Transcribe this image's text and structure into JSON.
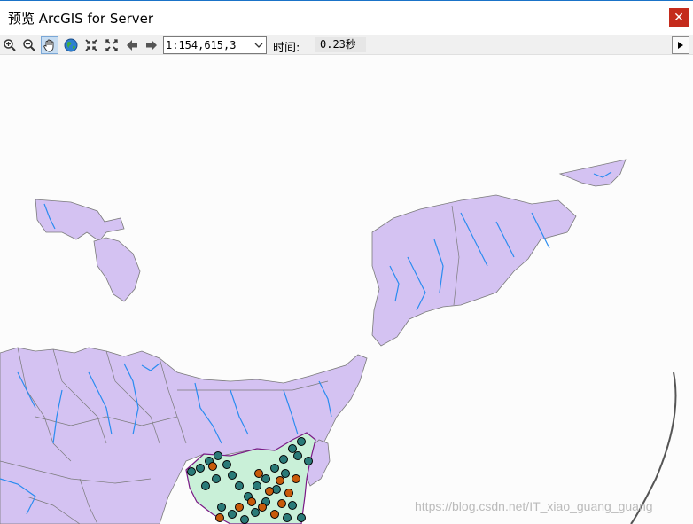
{
  "window": {
    "title": "预览 ArcGIS for Server",
    "close_glyph": "✕"
  },
  "toolbar": {
    "tools": [
      {
        "name": "zoom-in-icon"
      },
      {
        "name": "zoom-out-icon"
      },
      {
        "name": "pan-hand-icon",
        "active": true
      },
      {
        "name": "full-extent-globe-icon"
      },
      {
        "name": "fixed-zoom-in-icon"
      },
      {
        "name": "fixed-zoom-out-icon"
      },
      {
        "name": "back-arrow-icon"
      },
      {
        "name": "forward-arrow-icon"
      }
    ],
    "scale_value": "1:154,615,3",
    "time_label": "时间:",
    "time_value": "0.23秒"
  },
  "map": {
    "land_color": "#d4c2f2",
    "border_color": "#7a7a7a",
    "river_color": "#2a8cf0",
    "china_fill": "#c9f0d8",
    "china_border": "#7a1a86",
    "point_teal": "#2a7a78",
    "point_orange": "#c85a0a"
  },
  "watermark": "https://blog.csdn.net/IT_xiao_guang_guang"
}
